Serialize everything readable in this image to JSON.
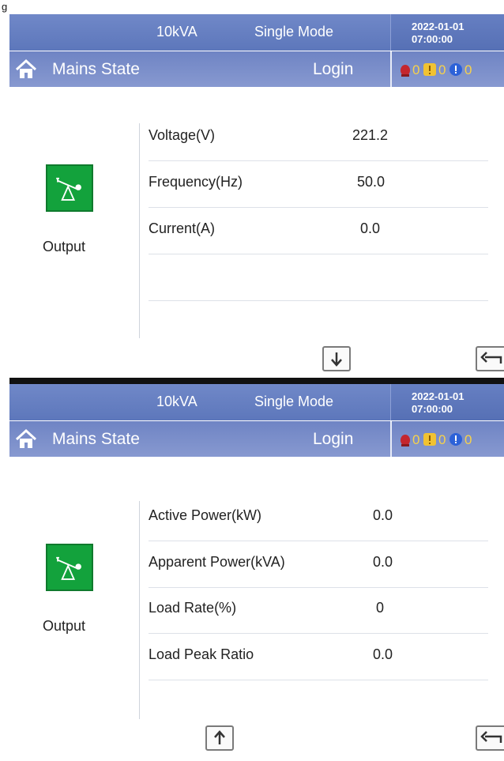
{
  "caption_label": "g",
  "screens": [
    {
      "header": {
        "model": "10kVA",
        "mode": "Single Mode",
        "date": "2022-01-01",
        "time": "07:00:00"
      },
      "titlebar": {
        "title": "Mains State",
        "login": "Login",
        "alarm_counts": [
          "0",
          "0",
          "0"
        ]
      },
      "output_label": "Output",
      "rows": [
        {
          "label": "Voltage(V)",
          "value": "221.2"
        },
        {
          "label": "Frequency(Hz)",
          "value": "50.0"
        },
        {
          "label": "Current(A)",
          "value": "0.0"
        }
      ],
      "nav_icon": "down-arrow-icon",
      "back_icon": "return-arrow-icon"
    },
    {
      "header": {
        "model": "10kVA",
        "mode": "Single Mode",
        "date": "2022-01-01",
        "time": "07:00:00"
      },
      "titlebar": {
        "title": "Mains State",
        "login": "Login",
        "alarm_counts": [
          "0",
          "0",
          "0"
        ]
      },
      "output_label": "Output",
      "rows": [
        {
          "label": "Active Power(kW)",
          "value": "0.0"
        },
        {
          "label": "Apparent Power(kVA)",
          "value": "0.0"
        },
        {
          "label": "Load Rate(%)",
          "value": "0"
        },
        {
          "label": "Load Peak Ratio",
          "value": "0.0"
        }
      ],
      "nav_icon": "up-arrow-icon",
      "back_icon": "return-arrow-icon"
    }
  ]
}
